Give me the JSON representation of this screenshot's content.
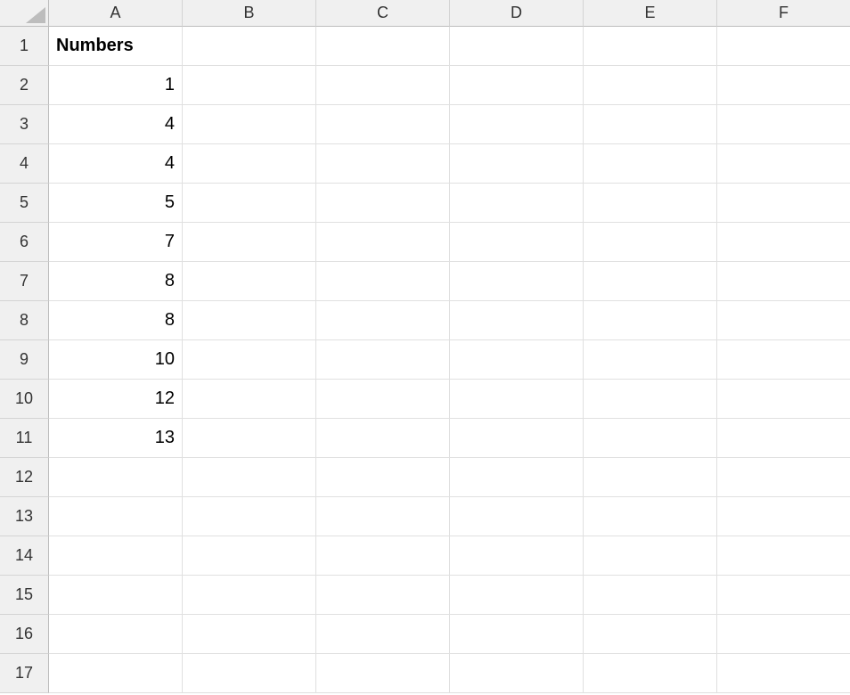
{
  "columns": [
    "A",
    "B",
    "C",
    "D",
    "E",
    "F"
  ],
  "rowCount": 17,
  "cells": {
    "A1": {
      "value": "Numbers",
      "bold": true,
      "align": "left"
    },
    "A2": {
      "value": "1",
      "align": "right"
    },
    "A3": {
      "value": "4",
      "align": "right"
    },
    "A4": {
      "value": "4",
      "align": "right"
    },
    "A5": {
      "value": "5",
      "align": "right"
    },
    "A6": {
      "value": "7",
      "align": "right"
    },
    "A7": {
      "value": "8",
      "align": "right"
    },
    "A8": {
      "value": "8",
      "align": "right"
    },
    "A9": {
      "value": "10",
      "align": "right"
    },
    "A10": {
      "value": "12",
      "align": "right"
    },
    "A11": {
      "value": "13",
      "align": "right"
    }
  }
}
